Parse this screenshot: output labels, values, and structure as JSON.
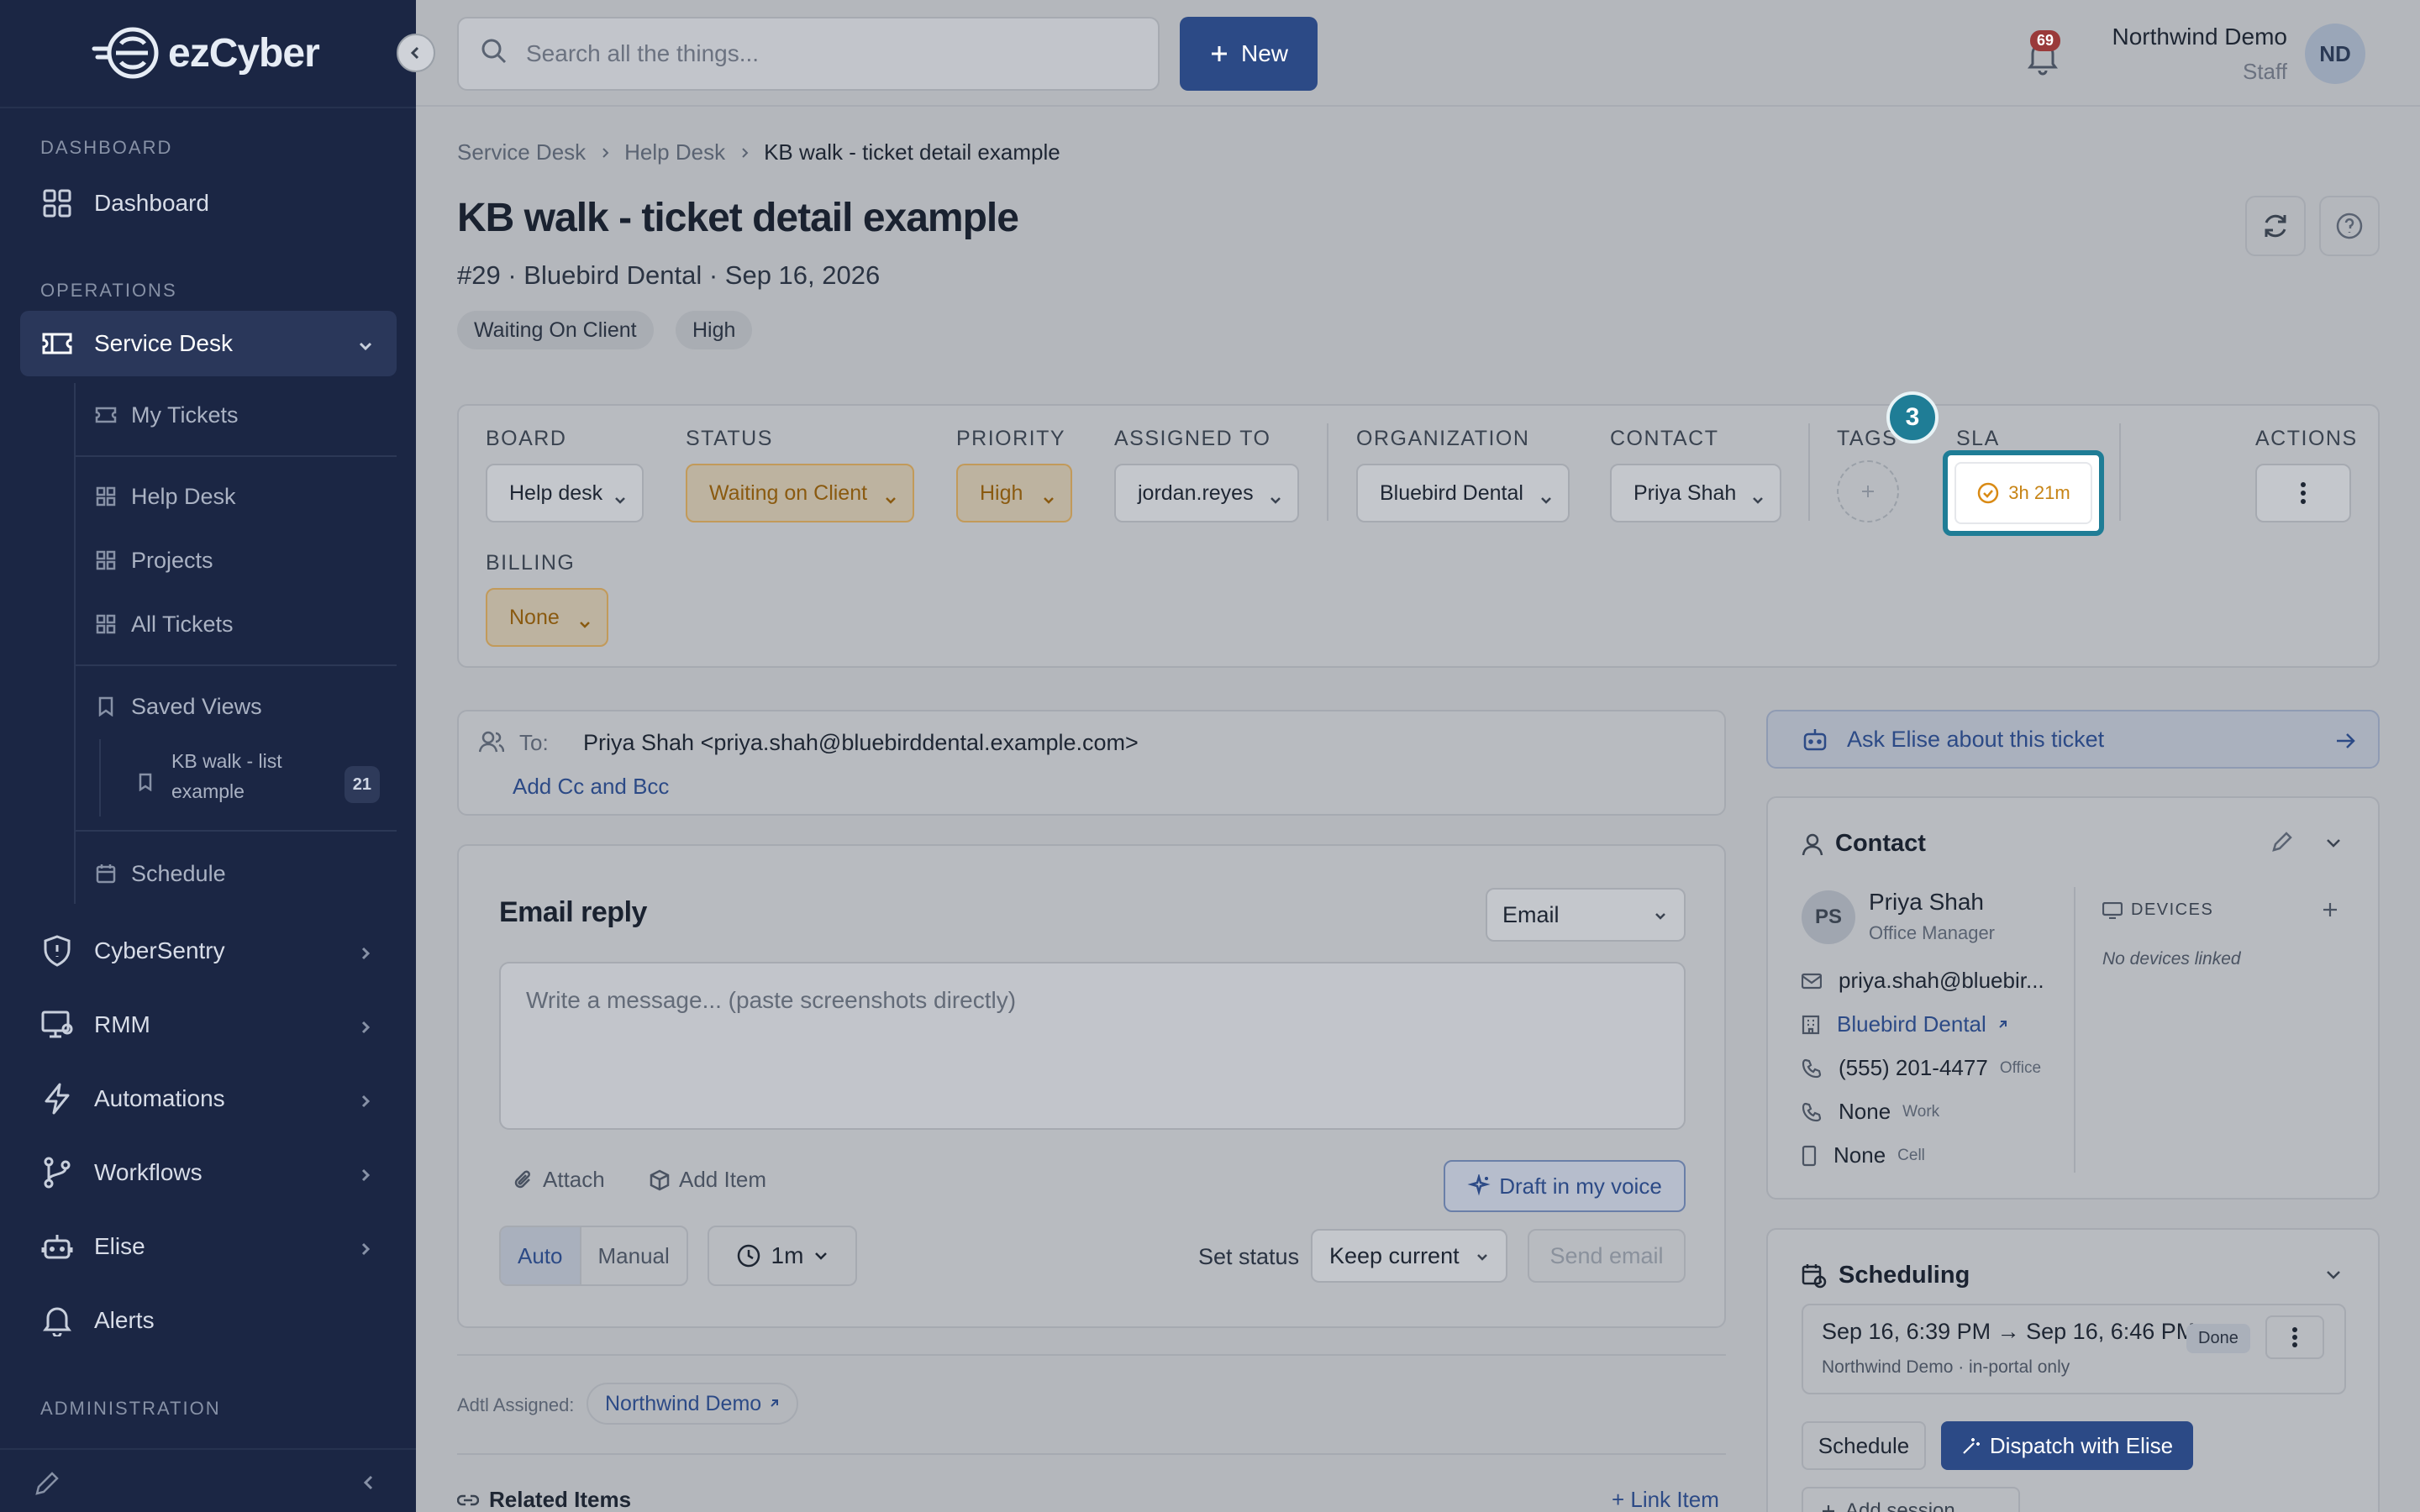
{
  "app": {
    "brand": "ezCyber",
    "accent": "#2c4a86",
    "highlight": "#1f7d96"
  },
  "sidebar": {
    "sections": {
      "dashboard": "DASHBOARD",
      "operations": "OPERATIONS",
      "administration": "ADMINISTRATION"
    },
    "items": {
      "dashboard": "Dashboard",
      "service_desk": "Service Desk",
      "cybersentry": "CyberSentry",
      "rmm": "RMM",
      "automations": "Automations",
      "workflows": "Workflows",
      "elise": "Elise",
      "alerts": "Alerts"
    },
    "sub": {
      "my_tickets": "My Tickets",
      "help_desk": "Help Desk",
      "projects": "Projects",
      "all_tickets": "All Tickets",
      "saved_views": "Saved Views",
      "kb_line1": "KB walk - list",
      "kb_line2": "example",
      "kb_count": "21",
      "schedule": "Schedule"
    }
  },
  "topbar": {
    "search_placeholder": "Search all the things...",
    "new_label": "New",
    "notifications": "69",
    "user_name": "Northwind Demo",
    "user_role": "Staff",
    "avatar": "ND"
  },
  "breadcrumb": {
    "a": "Service Desk",
    "b": "Help Desk",
    "c": "KB walk - ticket detail example"
  },
  "ticket": {
    "title": "KB walk - ticket detail example",
    "subtitle": "#29 · Bluebird Dental · Sep 16, 2026",
    "tags": [
      "Waiting On Client",
      "High"
    ]
  },
  "fields": {
    "board": {
      "label": "BOARD",
      "value": "Help desk"
    },
    "status": {
      "label": "STATUS",
      "value": "Waiting on Client"
    },
    "priority": {
      "label": "PRIORITY",
      "value": "High"
    },
    "assigned": {
      "label": "ASSIGNED TO",
      "value": "jordan.reyes"
    },
    "organization": {
      "label": "ORGANIZATION",
      "value": "Bluebird Dental"
    },
    "contact": {
      "label": "CONTACT",
      "value": "Priya Shah"
    },
    "tags": {
      "label": "TAGS"
    },
    "sla": {
      "label": "SLA",
      "value": "3h 21m"
    },
    "actions": {
      "label": "ACTIONS"
    },
    "billing": {
      "label": "BILLING",
      "value": "None"
    },
    "step": "3"
  },
  "compose": {
    "to_label": "To:",
    "to_value": "Priya Shah <priya.shah@bluebirddental.example.com>",
    "add_cc": "Add Cc and Bcc",
    "reply_title": "Email reply",
    "channel": "Email",
    "placeholder": "Write a message... (paste screenshots directly)",
    "attach": "Attach",
    "add_item": "Add Item",
    "draft": "Draft in my voice",
    "mode_auto": "Auto",
    "mode_manual": "Manual",
    "timer": "1m",
    "set_status": "Set status",
    "keep": "Keep current",
    "send": "Send email"
  },
  "footer": {
    "adtl_label": "Adtl Assigned:",
    "adtl_value": "Northwind Demo",
    "related": "Related Items",
    "link_item": "+ Link Item"
  },
  "right": {
    "ask": "Ask Elise about this ticket",
    "contact": {
      "title": "Contact",
      "avatar": "PS",
      "name": "Priya Shah",
      "role": "Office Manager",
      "email": "priya.shah@bluebir...",
      "org": "Bluebird Dental",
      "phone1": "(555) 201-4477",
      "phone1_label": "Office",
      "phone2": "None",
      "phone2_label": "Work",
      "phone3": "None",
      "phone3_label": "Cell",
      "devices": "DEVICES",
      "no_devices": "No devices linked"
    },
    "scheduling": {
      "title": "Scheduling",
      "session_time": "Sep 16, 6:39 PM → Sep 16, 6:46 PM",
      "session_sub": "Northwind Demo · in-portal only",
      "done": "Done",
      "schedule_btn": "Schedule",
      "dispatch_btn": "Dispatch with Elise",
      "add_session": "Add session"
    }
  }
}
